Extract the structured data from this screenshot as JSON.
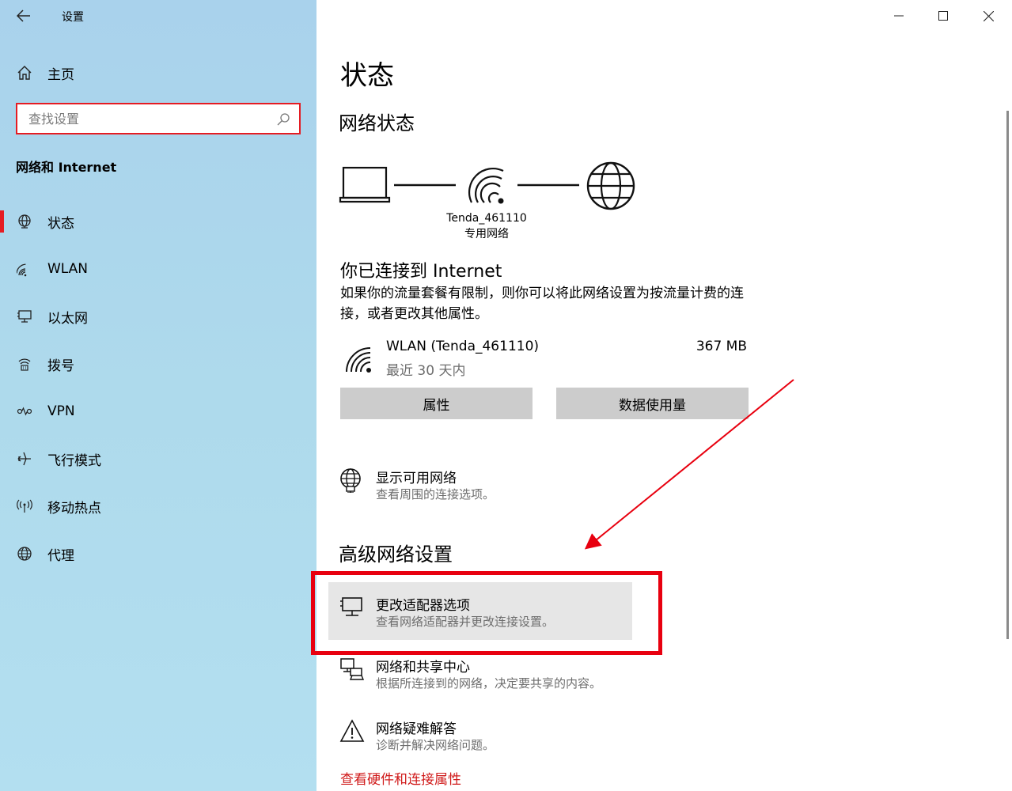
{
  "window": {
    "title": "设置",
    "buttons": {
      "minimize": "minimize-icon",
      "maximize": "maximize-icon",
      "close": "close-icon"
    }
  },
  "sidebar": {
    "home_label": "主页",
    "search_placeholder": "查找设置",
    "section_title": "网络和 Internet",
    "items": [
      {
        "label": "状态",
        "icon": "status-globe-icon",
        "active": true
      },
      {
        "label": "WLAN",
        "icon": "wifi-icon"
      },
      {
        "label": "以太网",
        "icon": "ethernet-icon"
      },
      {
        "label": "拨号",
        "icon": "dialup-icon"
      },
      {
        "label": "VPN",
        "icon": "vpn-icon"
      },
      {
        "label": "飞行模式",
        "icon": "airplane-icon"
      },
      {
        "label": "移动热点",
        "icon": "hotspot-icon"
      },
      {
        "label": "代理",
        "icon": "globe-icon"
      }
    ],
    "accent": "#e51c23"
  },
  "main": {
    "title": "状态",
    "network_status_heading": "网络状态",
    "network_name": "Tenda_461110",
    "network_type": "专用网络",
    "connected_title": "你已连接到 Internet",
    "connected_desc": "如果你的流量套餐有限制，则你可以将此网络设置为按流量计费的连接，或者更改其他属性。",
    "connection": {
      "name": "WLAN (Tenda_461110)",
      "period": "最近 30 天内",
      "usage": "367 MB"
    },
    "properties_button": "属性",
    "data_usage_button": "数据使用量",
    "show_networks": {
      "title": "显示可用网络",
      "desc": "查看周围的连接选项。"
    },
    "advanced_heading": "高级网络设置",
    "advanced_options": [
      {
        "title": "更改适配器选项",
        "desc": "查看网络适配器并更改连接设置。",
        "icon": "adapter-icon"
      },
      {
        "title": "网络和共享中心",
        "desc": "根据所连接到的网络，决定要共享的内容。",
        "icon": "sharing-center-icon"
      },
      {
        "title": "网络疑难解答",
        "desc": "诊断并解决网络问题。",
        "icon": "warning-icon"
      }
    ],
    "hardware_link": "查看硬件和连接属性",
    "annotation_color": "#e8000f"
  }
}
